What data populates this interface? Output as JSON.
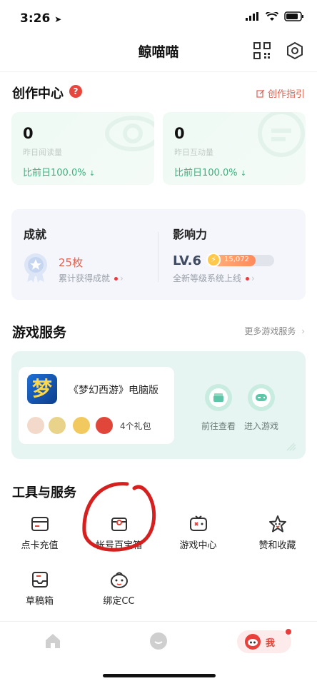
{
  "status": {
    "time": "3:26"
  },
  "header": {
    "title": "鲸喵喵"
  },
  "creation": {
    "title": "创作中心",
    "help": "?",
    "guide_label": "创作指引",
    "cards": [
      {
        "value": "0",
        "label": "昨日阅读量",
        "compare": "比前日100.0%"
      },
      {
        "value": "0",
        "label": "昨日互动量",
        "compare": "比前日100.0%"
      }
    ]
  },
  "achievements": {
    "title": "成就",
    "count": "25枚",
    "count_desc": "累计获得成就",
    "influence_title": "影响力",
    "level": "LV.6",
    "level_points": "15,072",
    "level_progress": 0.72,
    "level_desc": "全新等级系统上线"
  },
  "game_services": {
    "title": "游戏服务",
    "more_label": "更多游戏服务",
    "game_name": "《梦幻西游》电脑版",
    "game_logo_text": "梦",
    "gift_count": "4个礼包",
    "action_view": "前往查看",
    "action_enter": "进入游戏"
  },
  "tools": {
    "title": "工具与服务",
    "items": [
      {
        "label": "点卡充值",
        "icon": "card-icon"
      },
      {
        "label": "帐号百宝箱",
        "icon": "treasure-box-icon"
      },
      {
        "label": "游戏中心",
        "icon": "gamepad-icon"
      },
      {
        "label": "赞和收藏",
        "icon": "star-icon"
      },
      {
        "label": "草稿箱",
        "icon": "draft-box-icon"
      },
      {
        "label": "绑定CC",
        "icon": "cc-mascot-icon"
      }
    ]
  },
  "tabbar": {
    "me_label": "我"
  },
  "colors": {
    "accent_red": "#e0604f",
    "accent_green": "#3fae7f",
    "annotation_red": "#d61f1f"
  }
}
